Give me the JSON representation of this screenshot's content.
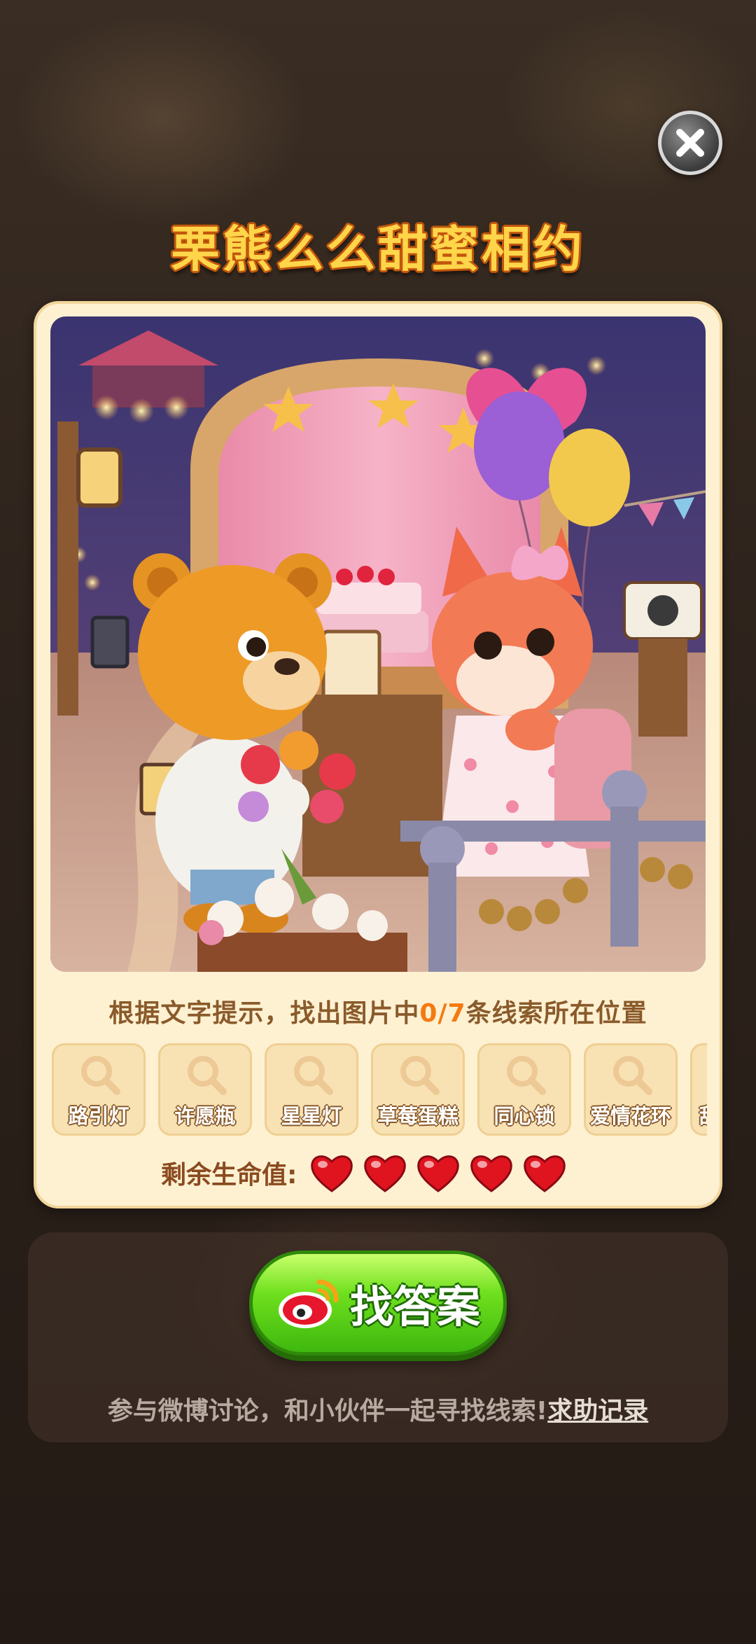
{
  "title": "栗熊么么甜蜜相约",
  "instruction": {
    "prefix": "根据文字提示，找出图片中",
    "found": "0/7",
    "suffix": "条线索所在位置"
  },
  "clues": [
    {
      "label": "路引灯",
      "icon": "magnifier-icon"
    },
    {
      "label": "许愿瓶",
      "icon": "magnifier-icon"
    },
    {
      "label": "星星灯",
      "icon": "magnifier-icon"
    },
    {
      "label": "草莓蛋糕",
      "icon": "magnifier-icon"
    },
    {
      "label": "同心锁",
      "icon": "magnifier-icon"
    },
    {
      "label": "爱情花环",
      "icon": "magnifier-icon"
    },
    {
      "label": "甜",
      "icon": "magnifier-icon"
    }
  ],
  "lives": {
    "label": "剩余生命值:",
    "remaining": 5,
    "icon": "heart-icon",
    "color": "#e0141f"
  },
  "answer_button": {
    "label": "找答案",
    "icon": "weibo-icon",
    "color": "#5ad314"
  },
  "footer": {
    "text": "参与微博讨论，和小伙伴一起寻找线索!",
    "link": "求助记录"
  },
  "colors": {
    "title": "#ffd54a",
    "panel": "#fdf1d2",
    "accent": "#f47a10"
  }
}
